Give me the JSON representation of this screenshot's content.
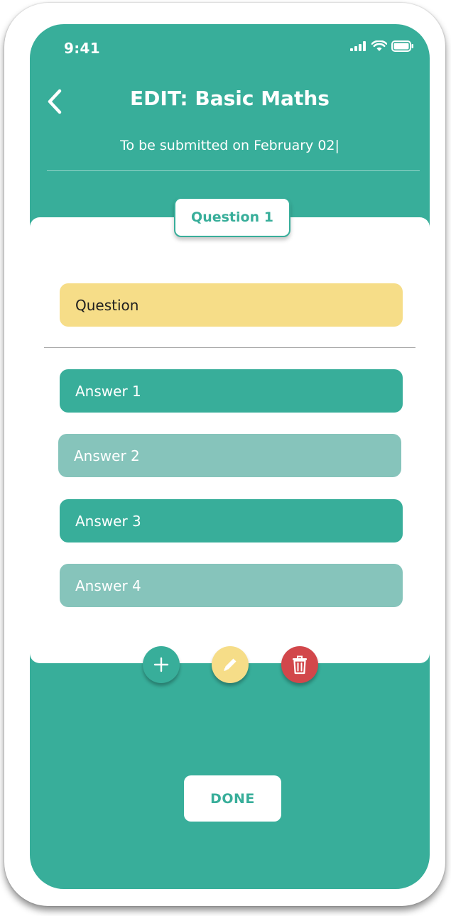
{
  "status_bar": {
    "time": "9:41"
  },
  "header": {
    "back_icon": "chevron-left-icon",
    "title": "EDIT: Basic Maths",
    "subtitle": "To be submitted on February 02|"
  },
  "question_card": {
    "tab_label": "Question 1",
    "question_placeholder": "Question",
    "answers": [
      {
        "label": "Answer 1",
        "style": "dark"
      },
      {
        "label": "Answer 2",
        "style": "light"
      },
      {
        "label": "Answer 3",
        "style": "dark"
      },
      {
        "label": "Answer 4",
        "style": "light"
      }
    ]
  },
  "actions": {
    "add_icon": "plus-icon",
    "edit_icon": "pencil-icon",
    "delete_icon": "trash-icon"
  },
  "footer": {
    "done_label": "DONE"
  },
  "colors": {
    "primary": "#38ae9a",
    "primary_light": "#86c4bb",
    "accent_yellow": "#f6dd88",
    "danger": "#d2474b",
    "white": "#ffffff"
  }
}
